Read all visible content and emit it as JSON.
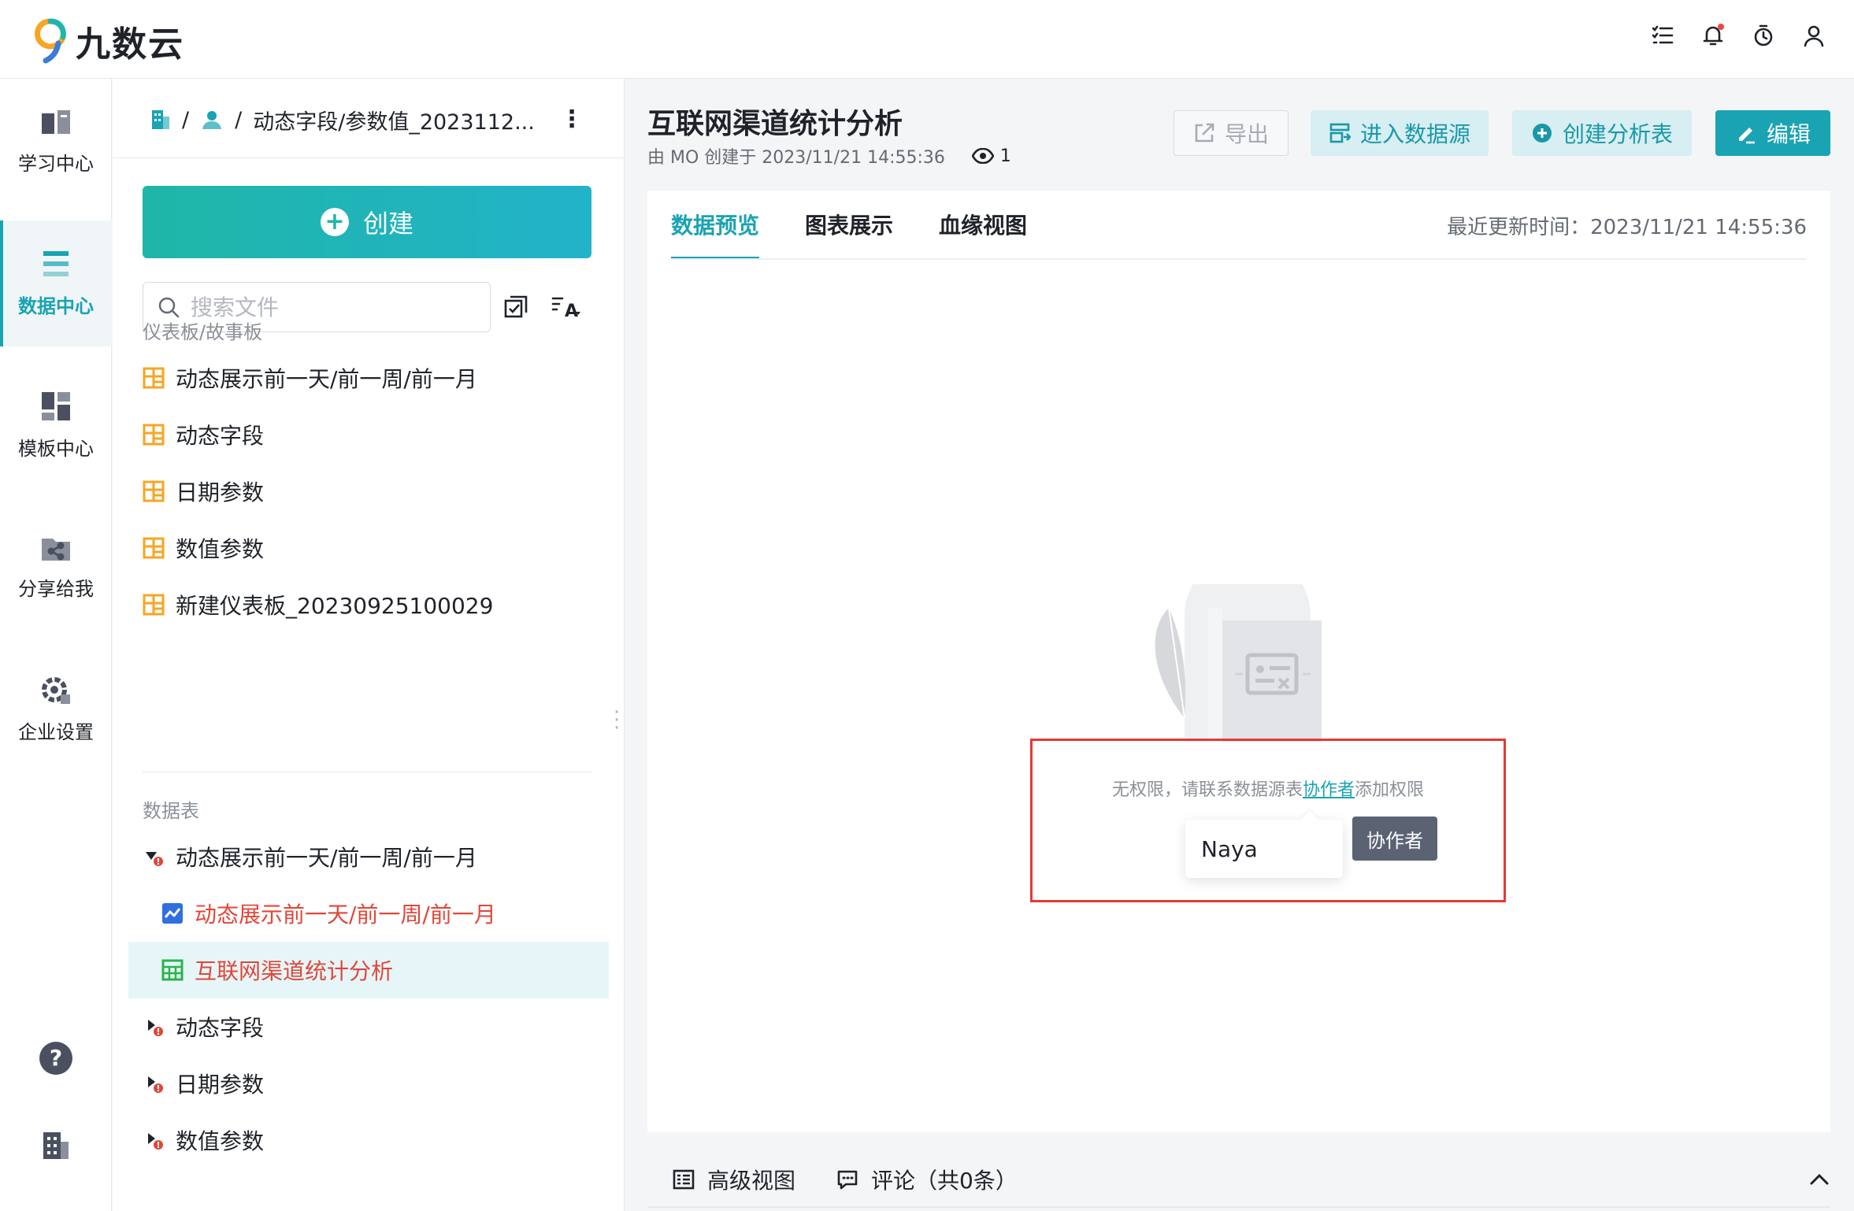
{
  "app": {
    "logo_text": "九数云"
  },
  "topbar": {
    "icons": [
      "list-check-icon",
      "bell-icon",
      "timer-icon",
      "user-icon"
    ]
  },
  "nav": {
    "items": [
      {
        "label": "学习中心",
        "icon": "book-icon"
      },
      {
        "label": "数据中心",
        "icon": "data-list-icon",
        "active": true
      },
      {
        "label": "模板中心",
        "icon": "template-grid-icon"
      },
      {
        "label": "分享给我",
        "icon": "share-folder-icon"
      },
      {
        "label": "企业设置",
        "icon": "gear-icon"
      }
    ],
    "bottom_icons": [
      "help-icon",
      "building-icon"
    ]
  },
  "filepanel": {
    "breadcrumb": {
      "sep1": "/",
      "sep2": "/",
      "current": "动态字段/参数值_2023112...",
      "more": "⋮"
    },
    "create_label": "创建",
    "search_placeholder": "搜索文件",
    "dashboard_section": "仪表板/故事板",
    "dashboards": [
      "动态展示前一天/前一周/前一月",
      "动态字段",
      "日期参数",
      "数值参数",
      "新建仪表板_20230925100029"
    ],
    "table_section": "数据表",
    "tables": [
      {
        "label": "动态展示前一天/前一周/前一月",
        "expanded": true
      },
      {
        "label": "动态展示前一天/前一周/前一月",
        "child": true,
        "icon": "chart-line-icon"
      },
      {
        "label": "互联网渠道统计分析",
        "child": true,
        "icon": "table-icon",
        "selected": true
      },
      {
        "label": "动态字段",
        "expanded": false
      },
      {
        "label": "日期参数",
        "expanded": false
      },
      {
        "label": "数值参数",
        "expanded": false
      }
    ]
  },
  "main": {
    "title": "互联网渠道统计分析",
    "meta": "由 MO 创建于 2023/11/21 14:55:36",
    "view_count": "1",
    "buttons": {
      "export": "导出",
      "enter_source": "进入数据源",
      "create_table": "创建分析表",
      "edit": "编辑"
    },
    "tabs": [
      "数据预览",
      "图表展示",
      "血缘视图"
    ],
    "updated": "最近更新时间：2023/11/21 14:55:36",
    "no_permission": {
      "prefix": "无权限，请联系数据源表",
      "link": "协作者",
      "suffix": "添加权限"
    },
    "collaborator_name": "Naya",
    "tooltip": "协作者",
    "bottom": {
      "advanced_view": "高级视图",
      "comments": "评论（共0条）"
    }
  },
  "colors": {
    "accent": "#1aa3b3",
    "danger": "#e53935",
    "dashboard_icon": "#f5a623"
  }
}
